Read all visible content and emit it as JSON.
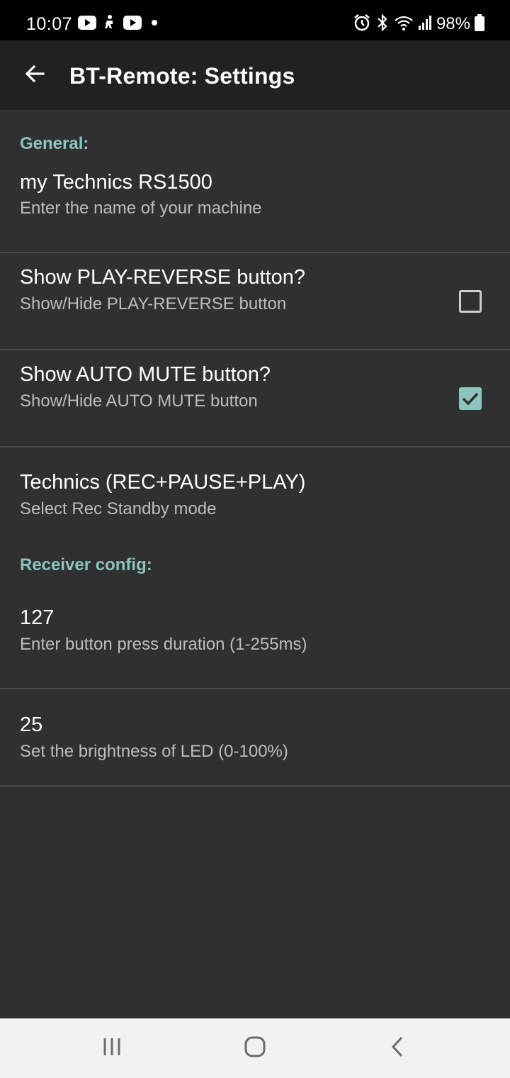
{
  "status_bar": {
    "time": "10:07",
    "battery": "98%",
    "icons": [
      "youtube-icon",
      "accessibility-icon",
      "youtube-icon",
      "dot-icon",
      "alarm-icon",
      "bluetooth-icon",
      "wifi-icon",
      "signal-icon",
      "battery-icon"
    ]
  },
  "app_bar": {
    "title": "BT-Remote: Settings",
    "back_icon": "arrow-back-icon"
  },
  "general": {
    "header": "General:",
    "machine_name": {
      "title": "my Technics RS1500",
      "summary": "Enter the name of your machine"
    },
    "play_reverse": {
      "title": "Show PLAY-REVERSE button?",
      "summary": "Show/Hide PLAY-REVERSE button",
      "checked": false
    },
    "auto_mute": {
      "title": "Show AUTO MUTE button?",
      "summary": "Show/Hide AUTO MUTE button",
      "checked": true
    },
    "rec_standby": {
      "title": "Technics (REC+PAUSE+PLAY)",
      "summary": "Select Rec Standby mode"
    }
  },
  "receiver": {
    "header": "Receiver config:",
    "press_duration": {
      "title": "127",
      "summary": "Enter button press duration (1-255ms)"
    },
    "led_brightness": {
      "title": "25",
      "summary": "Set the brightness of LED (0-100%)"
    }
  },
  "nav_bar": {
    "icons": [
      "recent-apps-icon",
      "home-icon",
      "back-icon"
    ]
  },
  "colors": {
    "accent": "#8cc4be",
    "background": "#303030",
    "app_bar": "#212121"
  }
}
